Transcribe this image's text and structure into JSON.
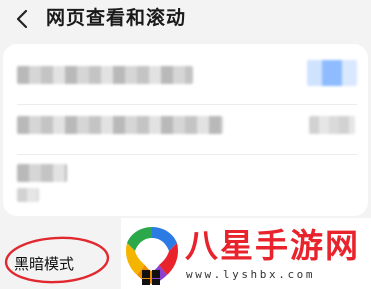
{
  "header": {
    "title": "网页查看和滚动",
    "back_icon": "chevron-left-icon"
  },
  "settings": {
    "dark_mode_label": "黑暗模式"
  },
  "watermark": {
    "logo_icon": "colorful-shield-logo",
    "text": "八星手游网",
    "url": "www.lyshbx.com"
  },
  "colors": {
    "background": "#f3f3f3",
    "card": "#ffffff",
    "annotation": "#e0282e",
    "watermark_text": "#e8232c"
  }
}
